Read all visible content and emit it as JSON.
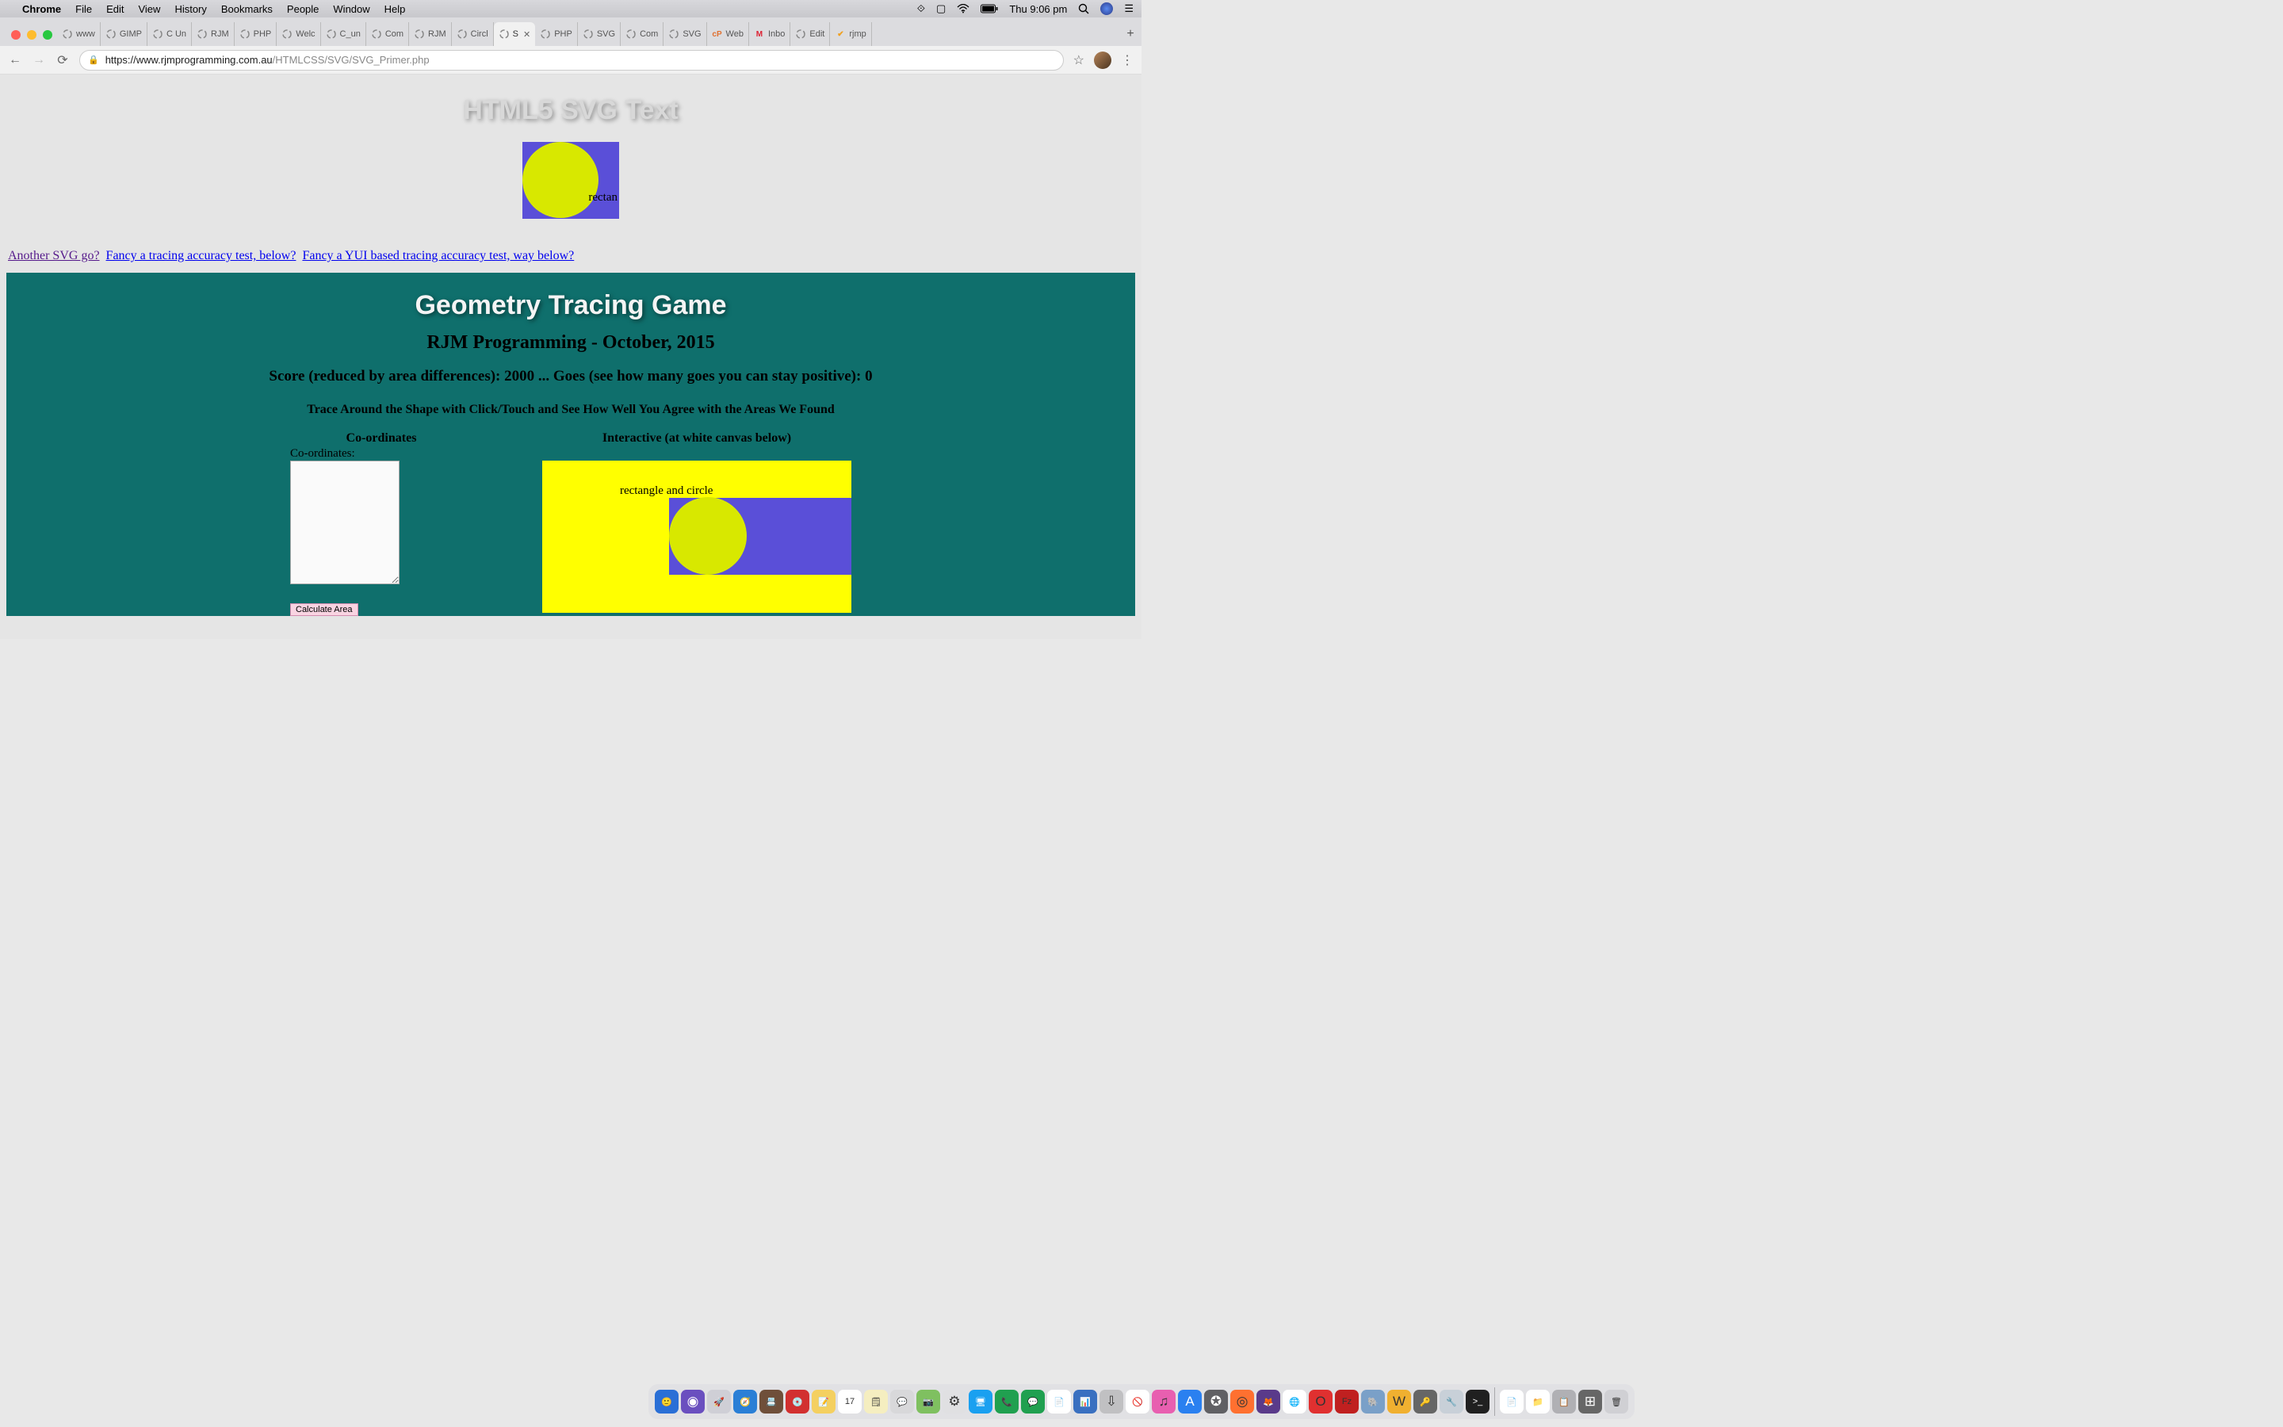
{
  "menubar": {
    "app": "Chrome",
    "items": [
      "File",
      "Edit",
      "View",
      "History",
      "Bookmarks",
      "People",
      "Window",
      "Help"
    ],
    "clock": "Thu 9:06 pm"
  },
  "tabs": [
    {
      "label": "www"
    },
    {
      "label": "GIMP"
    },
    {
      "label": "C Un"
    },
    {
      "label": "RJM"
    },
    {
      "label": "PHP"
    },
    {
      "label": "Welc"
    },
    {
      "label": "C_un"
    },
    {
      "label": "Com"
    },
    {
      "label": "RJM"
    },
    {
      "label": "Circl"
    },
    {
      "label": "S",
      "active": true
    },
    {
      "label": "PHP"
    },
    {
      "label": "SVG"
    },
    {
      "label": "Com"
    },
    {
      "label": "SVG"
    },
    {
      "label": "Web",
      "faviconText": "cP",
      "faviconColor": "#e07030"
    },
    {
      "label": "Inbo",
      "faviconText": "M",
      "faviconColor": "#d23"
    },
    {
      "label": "Edit"
    },
    {
      "label": "rjmp",
      "faviconText": "✔",
      "faviconColor": "#f0a020"
    }
  ],
  "url": {
    "lock": "🔒",
    "domain": "https://www.rjmprogramming.com.au",
    "path": "/HTMLCSS/SVG/SVG_Primer.php"
  },
  "page": {
    "title": "HTML5 SVG Text",
    "svg_label": "rectan",
    "links": {
      "a": "Another SVG go?",
      "b": "Fancy a tracing accuracy test, below?",
      "c": "Fancy a YUI based tracing accuracy test, way below?"
    }
  },
  "game": {
    "title": "Geometry Tracing Game",
    "subtitle": "RJM Programming - October, 2015",
    "score": "Score (reduced by area differences): 2000 ... Goes (see how many goes you can stay positive): 0",
    "instructions": "Trace Around the Shape with Click/Touch and See How Well You Agree with the Areas We Found",
    "col_coord_header": "Co-ordinates",
    "col_interactive_header": "Interactive (at white canvas below)",
    "coord_label": "Co-ordinates:",
    "calc_button": "Calculate Area",
    "canvas_text": "rectangle and circle"
  },
  "dock_icons": [
    {
      "bg": "#2a6fd6",
      "glyph": "🙂"
    },
    {
      "bg": "#6a4fbf",
      "glyph": "◉"
    },
    {
      "bg": "#cfcfd6",
      "glyph": "🚀"
    },
    {
      "bg": "#2a7fd6",
      "glyph": "🧭"
    },
    {
      "bg": "#6f4f3a",
      "glyph": "📇"
    },
    {
      "bg": "#d23030",
      "glyph": "💿"
    },
    {
      "bg": "#f4d060",
      "glyph": "📝"
    },
    {
      "bg": "#ffffff",
      "glyph": "17"
    },
    {
      "bg": "#f5eec0",
      "glyph": "🗒"
    },
    {
      "bg": "#d8d8da",
      "glyph": "💬"
    },
    {
      "bg": "#7fc060",
      "glyph": "📷"
    },
    {
      "bg": "#e0e0e2",
      "glyph": "⚙"
    },
    {
      "bg": "#1aa0f0",
      "glyph": "🖥"
    },
    {
      "bg": "#20a050",
      "glyph": "📞"
    },
    {
      "bg": "#20a050",
      "glyph": "💬"
    },
    {
      "bg": "#ffffff",
      "glyph": "📄"
    },
    {
      "bg": "#3a70c0",
      "glyph": "📊"
    },
    {
      "bg": "#c0c0c2",
      "glyph": "⇩"
    },
    {
      "bg": "#ffffff",
      "glyph": "🚫"
    },
    {
      "bg": "#e85fb0",
      "glyph": "♫"
    },
    {
      "bg": "#2a80f0",
      "glyph": "A"
    },
    {
      "bg": "#606064",
      "glyph": "✪"
    },
    {
      "bg": "#ff7030",
      "glyph": "◎"
    },
    {
      "bg": "#5a3a8a",
      "glyph": "🦊"
    },
    {
      "bg": "#ffffff",
      "glyph": "🌐"
    },
    {
      "bg": "#e03030",
      "glyph": "O"
    },
    {
      "bg": "#c02020",
      "glyph": "Fz"
    },
    {
      "bg": "#7aa0c8",
      "glyph": "🐘"
    },
    {
      "bg": "#f0b030",
      "glyph": "W"
    },
    {
      "bg": "#666",
      "glyph": "🔑"
    },
    {
      "bg": "#c8d0d8",
      "glyph": "🔧"
    },
    {
      "bg": "#202020",
      "glyph": ">_"
    },
    {
      "bg": "#ffffff",
      "glyph": "📄"
    },
    {
      "bg": "#ffffff",
      "glyph": "📁"
    },
    {
      "bg": "#b0b0b4",
      "glyph": "📋"
    },
    {
      "bg": "#666",
      "glyph": "⊞"
    },
    {
      "bg": "#d0d0d4",
      "glyph": "🗑"
    }
  ]
}
